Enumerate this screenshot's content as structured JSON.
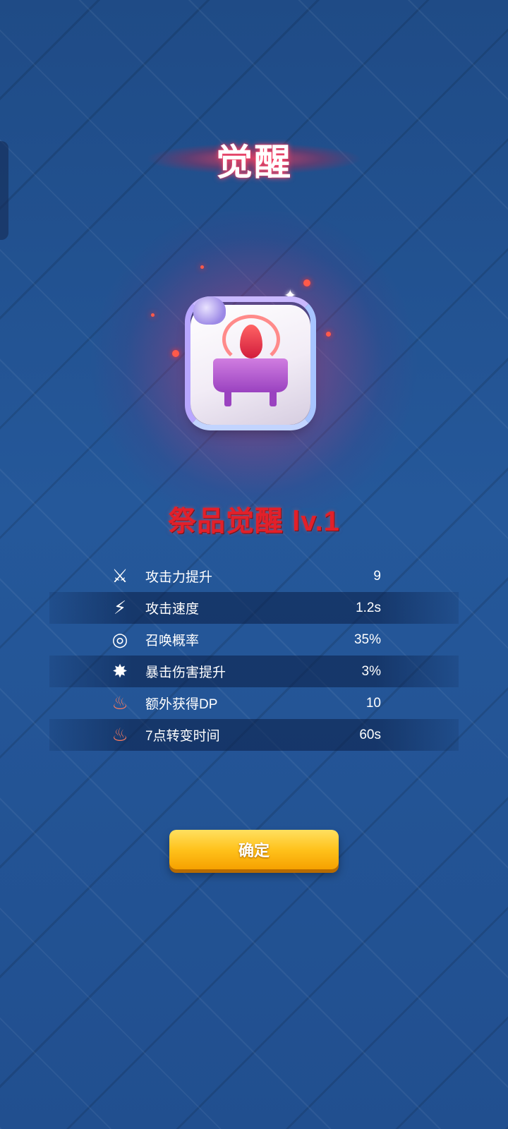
{
  "dialog": {
    "title": "觉醒",
    "skill_name": "祭品觉醒 lv.1",
    "confirm_label": "确定"
  },
  "stats": [
    {
      "icon": "sword-up-icon",
      "label": "攻击力提升",
      "value": "9"
    },
    {
      "icon": "speed-slash-icon",
      "label": "攻击速度",
      "value": "1.2s"
    },
    {
      "icon": "dragon-ring-icon",
      "label": "召唤概率",
      "value": "35%"
    },
    {
      "icon": "burst-crit-icon",
      "label": "暴击伤害提升",
      "value": "3%"
    },
    {
      "icon": "offering-basin-icon",
      "label": "额外获得DP",
      "value": "10"
    },
    {
      "icon": "flame-basin-icon",
      "label": "7点转变时间",
      "value": "60s"
    }
  ],
  "colors": {
    "title_glow": "#ff4a6a",
    "skill_title": "#e2202a",
    "button": "#ffc21c",
    "background": "#1f4e8e"
  }
}
